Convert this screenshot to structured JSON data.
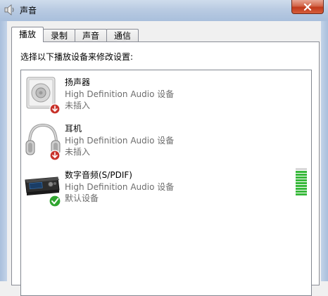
{
  "window": {
    "title": "声音",
    "icon": "speaker-icon"
  },
  "tabs": [
    {
      "label": "播放",
      "active": true
    },
    {
      "label": "录制",
      "active": false
    },
    {
      "label": "声音",
      "active": false
    },
    {
      "label": "通信",
      "active": false
    }
  ],
  "panel": {
    "instruction": "选择以下播放设备来修改设置:"
  },
  "devices": [
    {
      "name": "扬声器",
      "driver": "High Definition Audio 设备",
      "status": "未插入",
      "icon": "speaker-unplugged-icon"
    },
    {
      "name": "耳机",
      "driver": "High Definition Audio 设备",
      "status": "未插入",
      "icon": "headphones-unplugged-icon"
    },
    {
      "name": "数字音频(S/PDIF)",
      "driver": "High Definition Audio 设备",
      "status": "默认设备",
      "icon": "spdif-default-icon",
      "level": 0.85
    }
  ],
  "colors": {
    "unplugged_badge": "#c8332b",
    "default_badge": "#2fa52f",
    "meter_green": "#37b83a"
  }
}
